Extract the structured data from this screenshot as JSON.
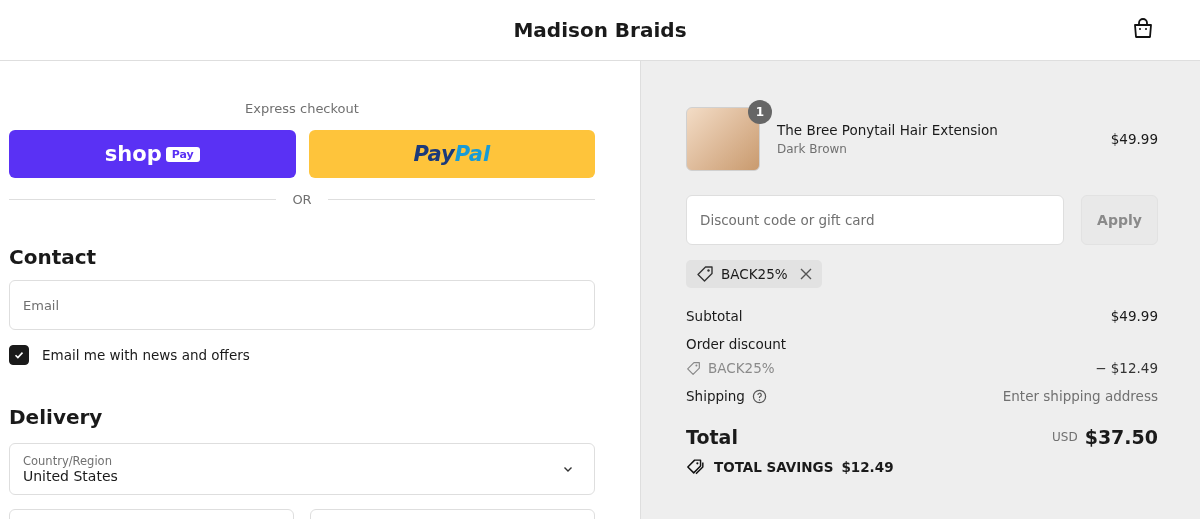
{
  "header": {
    "store_name": "Madison Braids"
  },
  "express": {
    "title": "Express checkout",
    "shop_pay": {
      "word": "shop",
      "badge": "Pay"
    },
    "paypal": {
      "part1": "Pay",
      "part2": "Pal"
    },
    "divider": "OR"
  },
  "contact": {
    "heading": "Contact",
    "email": {
      "placeholder": "Email"
    },
    "newsletter": {
      "label": "Email me with news and offers",
      "checked": true
    }
  },
  "delivery": {
    "heading": "Delivery",
    "country": {
      "label": "Country/Region",
      "value": "United States"
    }
  },
  "summary": {
    "item": {
      "name": "The Bree Ponytail Hair Extension",
      "variant": "Dark Brown",
      "price": "$49.99",
      "quantity": "1"
    },
    "discount": {
      "placeholder": "Discount code or gift card",
      "button": "Apply",
      "disabled": true,
      "applied_code": "BACK25%"
    },
    "lines": [
      {
        "kind": "plain",
        "label": "Subtotal",
        "value": "$49.99"
      },
      {
        "kind": "discount",
        "label": "Order discount",
        "code": "BACK25%",
        "value": "− $12.49"
      },
      {
        "kind": "help",
        "label": "Shipping",
        "value": "Enter shipping address"
      }
    ],
    "total": {
      "label": "Total",
      "currency": "USD",
      "value": "$37.50"
    },
    "savings": {
      "label": "TOTAL SAVINGS",
      "value": "$12.49"
    }
  }
}
